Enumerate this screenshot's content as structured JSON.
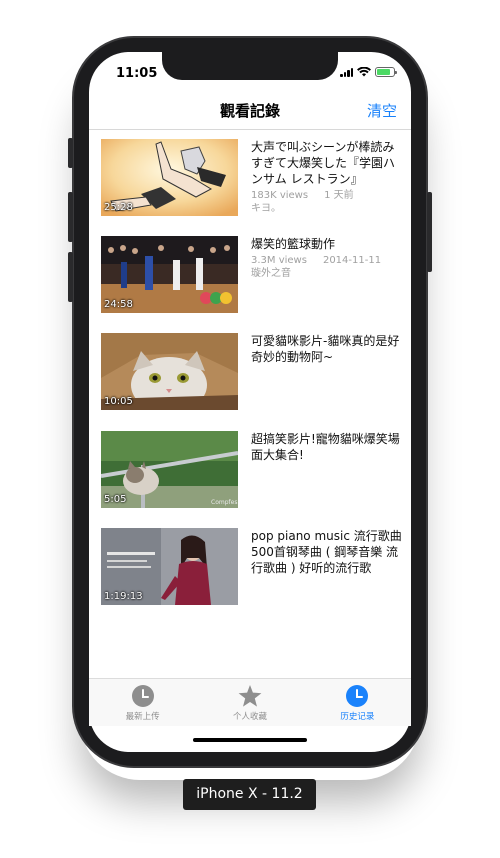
{
  "status_bar": {
    "time": "11:05"
  },
  "nav": {
    "title": "觀看記錄",
    "clear_label": "清空"
  },
  "videos": [
    {
      "title": "大声で叫ぶシーンが棒読みすぎて大爆笑した『学園ハンサム レストラン』",
      "duration": "25:28",
      "views": "183K views",
      "date": "1 天前",
      "channel": "キヨ。"
    },
    {
      "title": "爆笑的籃球動作",
      "duration": "24:58",
      "views": "3.3M views",
      "date": "2014-11-11",
      "channel": "璇外之音"
    },
    {
      "title": "可愛貓咪影片-貓咪真的是好奇妙的動物阿~",
      "duration": "10:05",
      "views": "",
      "date": "",
      "channel": ""
    },
    {
      "title": "超搞笑影片!寵物貓咪爆笑場面大集合!",
      "duration": "5:05",
      "views": "",
      "date": "",
      "channel": ""
    },
    {
      "title": "pop piano music 流行歌曲500首钢琴曲 ( 鋼琴音樂 流行歌曲 ) 好听的流行歌",
      "duration": "1:19:13",
      "views": "",
      "date": "",
      "channel": ""
    }
  ],
  "tabs": [
    {
      "label": "最新上传",
      "icon": "clock-icon",
      "active": false
    },
    {
      "label": "个人收藏",
      "icon": "star-icon",
      "active": false
    },
    {
      "label": "历史记录",
      "icon": "clock-icon",
      "active": true
    }
  ],
  "device_label": "iPhone X - 11.2",
  "colors": {
    "accent": "#1a82fb",
    "inactive": "#8e8e8e",
    "meta": "#a0a0a0"
  }
}
